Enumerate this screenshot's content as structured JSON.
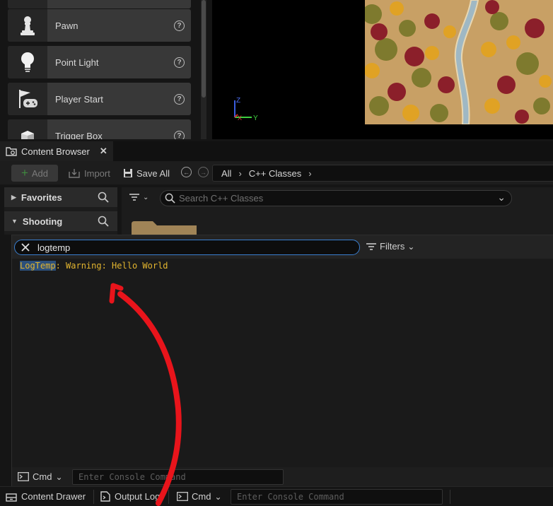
{
  "place_actors": {
    "items": [
      {
        "label": "",
        "icon": "actor-icon"
      },
      {
        "label": "Pawn",
        "icon": "pawn-icon"
      },
      {
        "label": "Point Light",
        "icon": "lightbulb-icon"
      },
      {
        "label": "Player Start",
        "icon": "flag-gamepad-icon"
      },
      {
        "label": "Trigger Box",
        "icon": "cube-icon"
      }
    ]
  },
  "viewport": {
    "axis_z": "Z",
    "axis_x": "X",
    "axis_y": "Y"
  },
  "content_browser": {
    "tab_title": "Content Browser",
    "toolbar": {
      "add_label": "Add",
      "import_label": "Import",
      "save_all_label": "Save All"
    },
    "breadcrumb": [
      "All",
      "C++ Classes"
    ],
    "sections": [
      {
        "label": "Favorites",
        "expanded": false
      },
      {
        "label": "Shooting",
        "expanded": true
      }
    ],
    "search_placeholder": "Search C++ Classes"
  },
  "output_log": {
    "filter_value": "logtemp",
    "filters_label": "Filters",
    "log_category": "LogTemp",
    "log_message": ": Warning: Hello World",
    "cmd_label": "Cmd",
    "cmd_placeholder": "Enter Console Command"
  },
  "status_bar": {
    "content_drawer_label": "Content Drawer",
    "output_log_label": "Output Log",
    "cmd_label": "Cmd",
    "cmd_placeholder": "Enter Console Command"
  },
  "colors": {
    "log_warning": "#e3b52f",
    "filter_focus_border": "#3a7fd0",
    "annotation_arrow": "#e8141b"
  }
}
